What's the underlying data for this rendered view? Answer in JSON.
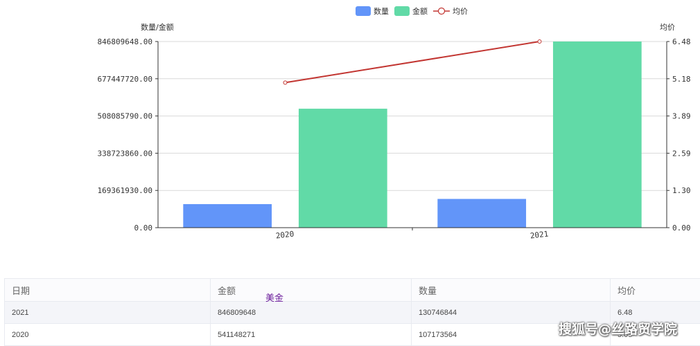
{
  "chart_data": {
    "type": "bar",
    "categories": [
      "2020",
      "2021"
    ],
    "series": [
      {
        "name": "数量",
        "kind": "bar",
        "axis": "left",
        "color": "#6295f9",
        "values": [
          107173564,
          130746844
        ]
      },
      {
        "name": "金额",
        "kind": "bar",
        "axis": "left",
        "color": "#61daa7",
        "values": [
          541148271,
          846809648
        ]
      },
      {
        "name": "均价",
        "kind": "line",
        "axis": "right",
        "color": "#c23531",
        "values": [
          5.05,
          6.48
        ]
      }
    ],
    "ylabel_left": "数量/金额",
    "ylabel_right": "均价",
    "ylim_left": [
      0,
      846809648
    ],
    "ylim_right": [
      0,
      6.48
    ],
    "yticks_left": [
      "0.00",
      "169361930.00",
      "338723860.00",
      "508085790.00",
      "677447720.00",
      "846809648.00"
    ],
    "yticks_right": [
      "0.00",
      "1.30",
      "2.59",
      "3.89",
      "5.18",
      "6.48"
    ],
    "grid": true,
    "legend_position": "top-center"
  },
  "table": {
    "headers": [
      "日期",
      "金额",
      "数量",
      "均价"
    ],
    "rows": [
      [
        "2021",
        "846809648",
        "130746844",
        "6.48"
      ],
      [
        "2020",
        "541148271",
        "107173564",
        "5.05"
      ]
    ]
  },
  "overlay_label": "美金",
  "watermark": "搜狐号@丝路贸学院"
}
